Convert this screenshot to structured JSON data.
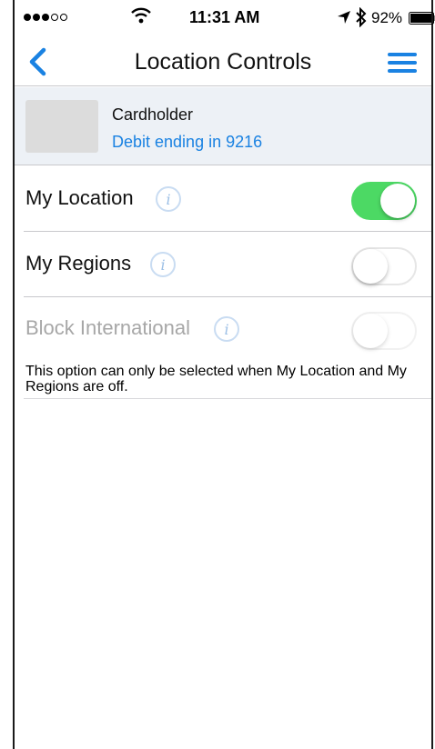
{
  "status_bar": {
    "time": "11:31 AM",
    "battery": "92%",
    "signal_filled": 3,
    "signal_empty": 2,
    "icons": [
      "wifi-icon",
      "location-arrow-icon",
      "bluetooth-icon",
      "battery-icon"
    ]
  },
  "nav": {
    "title": "Location Controls",
    "back_icon": "chevron-left-icon",
    "menu_icon": "hamburger-menu-icon"
  },
  "card": {
    "name": "Cardholder",
    "description": "Debit ending in 9216"
  },
  "settings": [
    {
      "label": "My Location",
      "enabled": true,
      "on": true
    },
    {
      "label": "My Regions",
      "enabled": true,
      "on": false
    },
    {
      "label": "Block International",
      "enabled": false,
      "on": false
    }
  ],
  "help_text": "This option can only be selected when My Location and My Regions are off.",
  "colors": {
    "accent": "#1a82e2",
    "toggle_on": "#4cd964",
    "header_bg": "#edf1f6",
    "disabled_text": "#a7a7a7"
  }
}
